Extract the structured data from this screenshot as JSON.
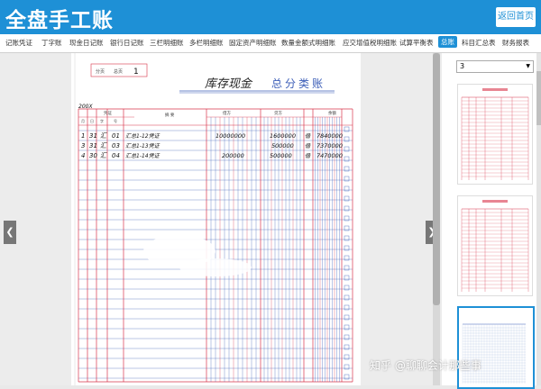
{
  "header": {
    "title": "全盘手工账",
    "home_button": "返回首页"
  },
  "tabs": [
    {
      "label": "记账凭证",
      "active": false
    },
    {
      "label": "丁字账",
      "active": false
    },
    {
      "label": "现金日记账",
      "active": false
    },
    {
      "label": "银行日记账",
      "active": false
    },
    {
      "label": "三栏明细账",
      "active": false
    },
    {
      "label": "多栏明细账",
      "active": false
    },
    {
      "label": "固定资产明细账",
      "active": false
    },
    {
      "label": "数量金额式明细账",
      "active": false
    },
    {
      "label": "应交增值税明细账",
      "active": false
    },
    {
      "label": "试算平衡表",
      "active": false
    },
    {
      "label": "总账",
      "active": true
    },
    {
      "label": "科目汇总表",
      "active": false
    },
    {
      "label": "财务报表",
      "active": false
    }
  ],
  "ledger": {
    "page_label": "分页",
    "page_no_label": "总页",
    "page_no": "1",
    "title_handwritten": "库存现金",
    "title_printed": "总分类账",
    "year": "200X",
    "header_date": "年",
    "header_voucher": "凭证",
    "header_summary": "摘 要",
    "header_debit": "借方",
    "header_credit": "贷方",
    "header_balance": "余额",
    "header_month": "月",
    "header_day": "日",
    "header_type": "字",
    "header_no": "号",
    "rows": [
      {
        "month": "1",
        "day": "31",
        "type": "汇",
        "no": "01",
        "summary": "汇总1-12凭证",
        "debit": "10000000",
        "credit": "1600000",
        "dc": "借",
        "balance": "7840000"
      },
      {
        "month": "3",
        "day": "31",
        "type": "汇",
        "no": "03",
        "summary": "汇总1-13凭证",
        "debit": "",
        "credit": "500000",
        "dc": "借",
        "balance": "7370000"
      },
      {
        "month": "4",
        "day": "30",
        "type": "汇",
        "no": "04",
        "summary": "汇总1-14凭证",
        "debit": "200000",
        "credit": "500000",
        "dc": "借",
        "balance": "7470000"
      }
    ]
  },
  "sidebar": {
    "selected_page": "3"
  },
  "watermark": "知乎 @聊聊会计那些事",
  "colors": {
    "accent": "#1e90d6",
    "red_line": "#d8344a",
    "blue_line": "#3d5fb8"
  }
}
